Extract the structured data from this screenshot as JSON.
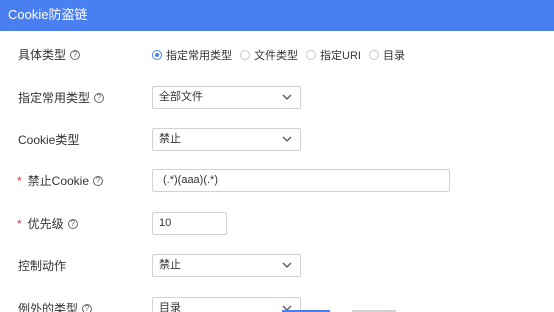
{
  "header": {
    "title": "Cookie防盗链"
  },
  "rows": {
    "specific_type": {
      "label": "具体类型",
      "options": [
        "指定常用类型",
        "文件类型",
        "指定URI",
        "目录"
      ],
      "selected": "指定常用类型"
    },
    "common_type": {
      "label": "指定常用类型",
      "value": "全部文件"
    },
    "cookie_type": {
      "label": "Cookie类型",
      "value": "禁止"
    },
    "forbid_cookie": {
      "label": "禁止Cookie",
      "required_mark": "*",
      "value": "(.*)(aaa)(.*)"
    },
    "priority": {
      "label": "优先级",
      "required_mark": "*",
      "value": "10"
    },
    "control_action": {
      "label": "控制动作",
      "value": "禁止"
    },
    "exception_type": {
      "label": "例外的类型",
      "value": "目录"
    }
  },
  "colors": {
    "accent": "#4a7ff2",
    "required": "#e4393c"
  }
}
